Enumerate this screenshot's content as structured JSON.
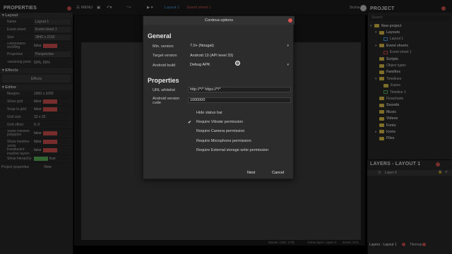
{
  "topbar": {
    "properties_title": "PROPERTIES",
    "menu_label": "MENU",
    "tabs": [
      {
        "label": "Layout 1"
      },
      {
        "label": "Event sheet 1"
      }
    ],
    "signin_label": "Scirra",
    "project_title": "PROJECT"
  },
  "properties": {
    "layout_section": "Layout",
    "rows_layout": [
      {
        "label": "Name",
        "value": "Layout 1"
      },
      {
        "label": "Event sheet",
        "value": "Event sheet 1"
      },
      {
        "label": "Size",
        "value": "3840 x 2160"
      },
      {
        "label": "Unbounded scrolling",
        "value": "false"
      },
      {
        "label": "Projection",
        "value": "Perspective"
      },
      {
        "label": "Vanishing point",
        "value": "50%, 50%"
      }
    ],
    "effects_section": "Effects",
    "effects_button": "Effects",
    "editor_section": "Editor",
    "rows_editor": [
      {
        "label": "Margins",
        "value": "1000 x 1000"
      },
      {
        "label": "Show grid",
        "value": "false"
      },
      {
        "label": "Snap to grid",
        "value": "false"
      },
      {
        "label": "Grid size",
        "value": "32 x 32"
      },
      {
        "label": "Grid offset",
        "value": "0, 0"
      },
      {
        "label": "Show collision polygons",
        "value": "false"
      },
      {
        "label": "Show meshes",
        "value": "false"
      },
      {
        "label": "Show translucent inactive layers",
        "value": "false"
      },
      {
        "label": "Show hierarchy",
        "value": "true"
      }
    ],
    "project_properties_label": "Project properties",
    "view_label": "View"
  },
  "project": {
    "search_placeholder": "Search",
    "tree": [
      {
        "label": "New project",
        "kind": "folder",
        "level": 0,
        "bold": true
      },
      {
        "label": "Layouts",
        "kind": "folder",
        "level": 1,
        "bold": true
      },
      {
        "label": "Layout 1",
        "kind": "layout",
        "level": 2,
        "bold": false
      },
      {
        "label": "Event sheets",
        "kind": "folder",
        "level": 1,
        "bold": true
      },
      {
        "label": "Event sheet 1",
        "kind": "events",
        "level": 2,
        "bold": false
      },
      {
        "label": "Scripts",
        "kind": "folder",
        "level": 1,
        "bold": true
      },
      {
        "label": "Object types",
        "kind": "folder",
        "level": 1,
        "bold": false
      },
      {
        "label": "Families",
        "kind": "folder",
        "level": 1,
        "bold": true
      },
      {
        "label": "Timelines",
        "kind": "folder",
        "level": 1,
        "bold": false
      },
      {
        "label": "Eases",
        "kind": "folder",
        "level": 2,
        "bold": false
      },
      {
        "label": "Timeline 1",
        "kind": "timeline",
        "level": 2,
        "bold": false
      },
      {
        "label": "Flowcharts",
        "kind": "folder",
        "level": 1,
        "bold": false
      },
      {
        "label": "Sounds",
        "kind": "folder",
        "level": 1,
        "bold": true
      },
      {
        "label": "Music",
        "kind": "folder",
        "level": 1,
        "bold": true
      },
      {
        "label": "Videos",
        "kind": "folder",
        "level": 1,
        "bold": true
      },
      {
        "label": "Fonts",
        "kind": "folder",
        "level": 1,
        "bold": true
      },
      {
        "label": "Icons",
        "kind": "folder",
        "level": 1,
        "bold": true
      },
      {
        "label": "Files",
        "kind": "folder",
        "level": 1,
        "bold": true
      }
    ]
  },
  "layers": {
    "title": "LAYERS - LAYOUT 1",
    "row_index": "0",
    "row_name": "Layer 0",
    "bottom_tab_active": "Layers - Layout 1",
    "bottom_tab_other": "Tilemap"
  },
  "status": {
    "mouse": "Mouse: (420, 178)",
    "active_layer": "Active layer: Layer 0",
    "zoom": "Zoom: 41%"
  },
  "dialog": {
    "title": "Cordova options",
    "general_heading": "General",
    "min_version_label": "Min. version",
    "min_version_value": "7.0+ (Nougat)",
    "target_version_label": "Target version",
    "target_version_value": "Android 13 (API level 33)",
    "android_build_label": "Android build",
    "android_build_value": "Debug APK",
    "properties_heading": "Properties",
    "url_whitelist_label": "URL whitelist",
    "url_whitelist_value": "http://*/* https://*/*",
    "version_code_label": "Android version code",
    "version_code_value": "1000000",
    "checkboxes": [
      {
        "label": "Hide status bar",
        "checked": false
      },
      {
        "label": "Require Vibrate permission",
        "checked": true
      },
      {
        "label": "Require Camera permission",
        "checked": false
      },
      {
        "label": "Require Microphone permission",
        "checked": false
      },
      {
        "label": "Require External storage write permission",
        "checked": false
      }
    ],
    "next_label": "Next",
    "cancel_label": "Cancel"
  }
}
